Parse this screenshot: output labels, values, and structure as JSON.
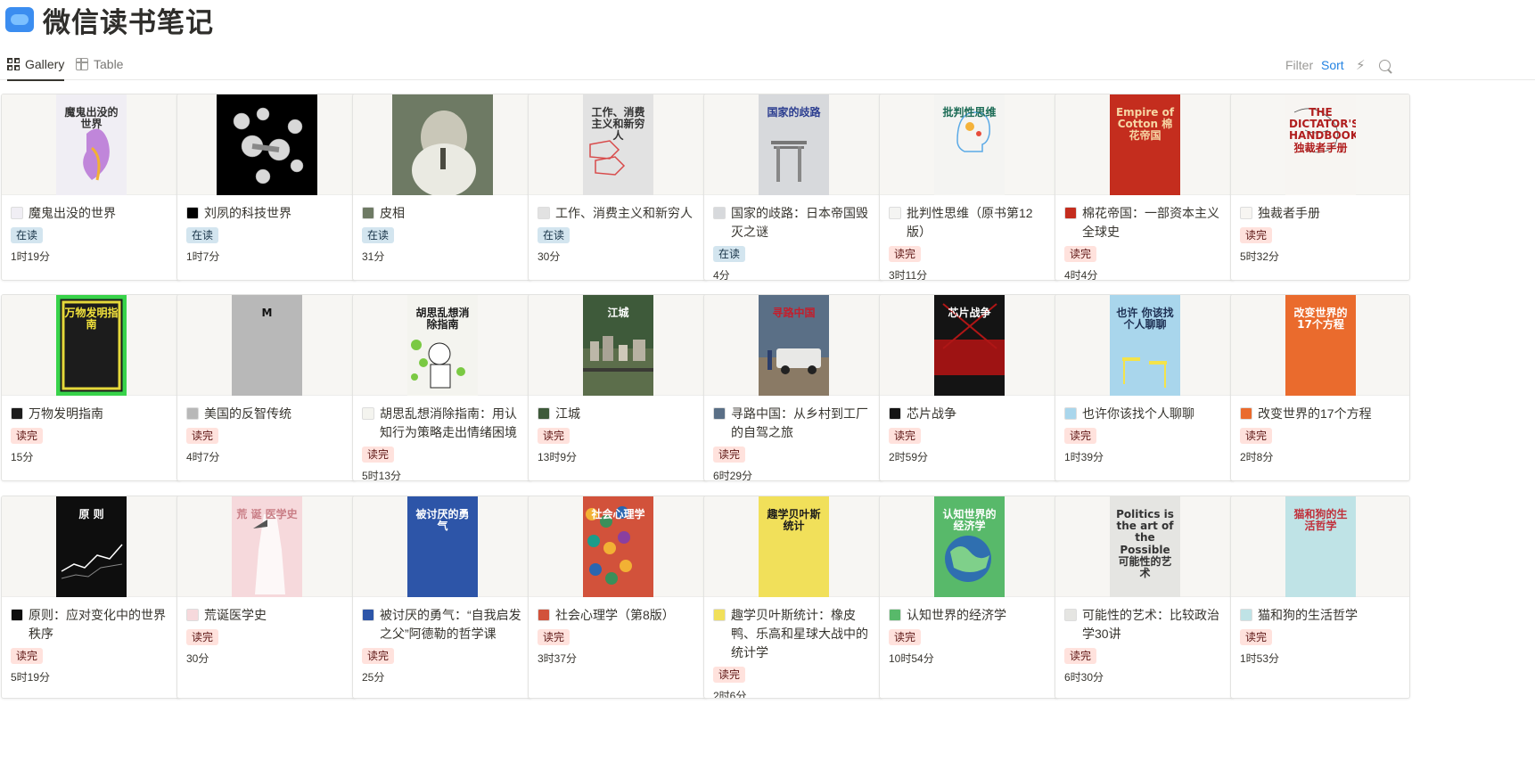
{
  "page": {
    "title": "微信读书笔记",
    "icon": "wechat-read-icon"
  },
  "views": {
    "gallery_label": "Gallery",
    "table_label": "Table"
  },
  "toolbar": {
    "filter_label": "Filter",
    "sort_label": "Sort",
    "automation_icon": "lightning-icon",
    "search_icon": "search-icon"
  },
  "colors": {
    "tag_reading_bg": "#d3e5ef",
    "tag_done_bg": "#ffe2dd",
    "accent": "#2383e2"
  },
  "cards": [
    {
      "title": "魔鬼出没的世界",
      "status": "在读",
      "duration": "1时19分",
      "cover_color": "#f0eef4",
      "cover_text": "魔鬼出没的世界",
      "cover_text_color": "#333",
      "art": "magic"
    },
    {
      "title": "刘夙的科技世界",
      "status": "在读",
      "duration": "1时7分",
      "cover_color": "#000000",
      "cover_text": "",
      "cover_text_color": "#fff",
      "art": "molecule",
      "wide": true
    },
    {
      "title": "皮相",
      "status": "在读",
      "duration": "31分",
      "cover_color": "#6e7a64",
      "cover_text": "",
      "cover_text_color": "#fff",
      "art": "portrait",
      "wide": true
    },
    {
      "title": "工作、消费主义和新穷人",
      "status": "在读",
      "duration": "30分",
      "cover_color": "#e2e2e2",
      "cover_text": "工作、消费主义和新穷人",
      "cover_text_color": "#333",
      "art": "tag"
    },
    {
      "title": "国家的歧路：日本帝国毁灭之谜",
      "status": "在读",
      "duration": "4分",
      "cover_color": "#d7d9dc",
      "cover_text": "国家的歧路",
      "cover_text_color": "#2a3c8f",
      "art": "torii"
    },
    {
      "title": "批判性思维（原书第12版）",
      "status": "读完",
      "duration": "3时11分",
      "cover_color": "#f4f4f2",
      "cover_text": "批判性思维",
      "cover_text_color": "#1b6b55",
      "art": "head"
    },
    {
      "title": "棉花帝国：一部资本主义全球史",
      "status": "读完",
      "duration": "4时4分",
      "cover_color": "#c42d1e",
      "cover_text": "Empire of Cotton 棉花帝国",
      "cover_text_color": "#f6d6a4",
      "art": "plain"
    },
    {
      "title": "独裁者手册",
      "status": "读完",
      "duration": "5时32分",
      "cover_color": "#f7f5f2",
      "cover_text": "THE DICTATOR'S HANDBOOK 独裁者手册",
      "cover_text_color": "#b01e1e",
      "art": "sketch"
    },
    {
      "title": "万物发明指南",
      "status": "读完",
      "duration": "15分",
      "cover_color": "#1c1c1c",
      "cover_text": "万物发明指南",
      "cover_text_color": "#f2e23c",
      "art": "frame"
    },
    {
      "title": "美国的反智传统",
      "status": "读完",
      "duration": "4时7分",
      "cover_color": "#b8b8b8",
      "cover_text": "M",
      "cover_text_color": "#111",
      "art": "plain"
    },
    {
      "title": "胡思乱想消除指南：用认知行为策略走出情绪困境",
      "status": "读完",
      "duration": "5时13分",
      "cover_color": "#f4f4ef",
      "cover_text": "胡思乱想消除指南",
      "cover_text_color": "#1b1b1b",
      "art": "bubbles"
    },
    {
      "title": "江城",
      "status": "读完",
      "duration": "13时9分",
      "cover_color": "#3e5a3a",
      "cover_text": "江城",
      "cover_text_color": "#fff",
      "art": "city"
    },
    {
      "title": "寻路中国：从乡村到工厂的自驾之旅",
      "status": "读完",
      "duration": "6时29分",
      "cover_color": "#5a6f86",
      "cover_text": "寻路中国",
      "cover_text_color": "#c41e2c",
      "art": "car"
    },
    {
      "title": "芯片战争",
      "status": "读完",
      "duration": "2时59分",
      "cover_color": "#141414",
      "cover_text": "芯片战争",
      "cover_text_color": "#fff",
      "art": "chip"
    },
    {
      "title": "也许你该找个人聊聊",
      "status": "读完",
      "duration": "1时39分",
      "cover_color": "#a9d6ec",
      "cover_text": "也许 你该找个人聊聊",
      "cover_text_color": "#1d2f52",
      "art": "chairs"
    },
    {
      "title": "改变世界的17个方程",
      "status": "读完",
      "duration": "2时8分",
      "cover_color": "#ea6b2d",
      "cover_text": "改变世界的17个方程",
      "cover_text_color": "#fff",
      "art": "plain"
    },
    {
      "title": "原则：应对变化中的世界秩序",
      "status": "读完",
      "duration": "5时19分",
      "cover_color": "#0e0e0e",
      "cover_text": "原 则",
      "cover_text_color": "#fff",
      "art": "lines"
    },
    {
      "title": "荒诞医学史",
      "status": "读完",
      "duration": "30分",
      "cover_color": "#f6d9dc",
      "cover_text": "荒 诞 医学史",
      "cover_text_color": "#c97e86",
      "art": "plague"
    },
    {
      "title": "被讨厌的勇气：“自我启发之父”阿德勒的哲学课",
      "status": "读完",
      "duration": "25分",
      "cover_color": "#2d55a8",
      "cover_text": "被讨厌的勇气",
      "cover_text_color": "#fff",
      "art": "plain"
    },
    {
      "title": "社会心理学（第8版）",
      "status": "读完",
      "duration": "3时37分",
      "cover_color": "#d2523b",
      "cover_text": "社会心理学",
      "cover_text_color": "#fff",
      "art": "crowd"
    },
    {
      "title": "趣学贝叶斯统计：橡皮鸭、乐高和星球大战中的统计学",
      "status": "读完",
      "duration": "2时6分",
      "cover_color": "#f1e05a",
      "cover_text": "趣学贝叶斯统计",
      "cover_text_color": "#1a1a1a",
      "art": "plain"
    },
    {
      "title": "认知世界的经济学",
      "status": "读完",
      "duration": "10时54分",
      "cover_color": "#58b96a",
      "cover_text": "认知世界的经济学",
      "cover_text_color": "#fff",
      "art": "globe"
    },
    {
      "title": "可能性的艺术：比较政治学30讲",
      "status": "读完",
      "duration": "6时30分",
      "cover_color": "#e5e5e2",
      "cover_text": "Politics is the art of the Possible 可能性的艺术",
      "cover_text_color": "#333",
      "art": "plain"
    },
    {
      "title": "猫和狗的生活哲学",
      "status": "读完",
      "duration": "1时53分",
      "cover_color": "#bfe3e6",
      "cover_text": "猫和狗的生活哲学",
      "cover_text_color": "#c02f3a",
      "art": "plain"
    }
  ]
}
